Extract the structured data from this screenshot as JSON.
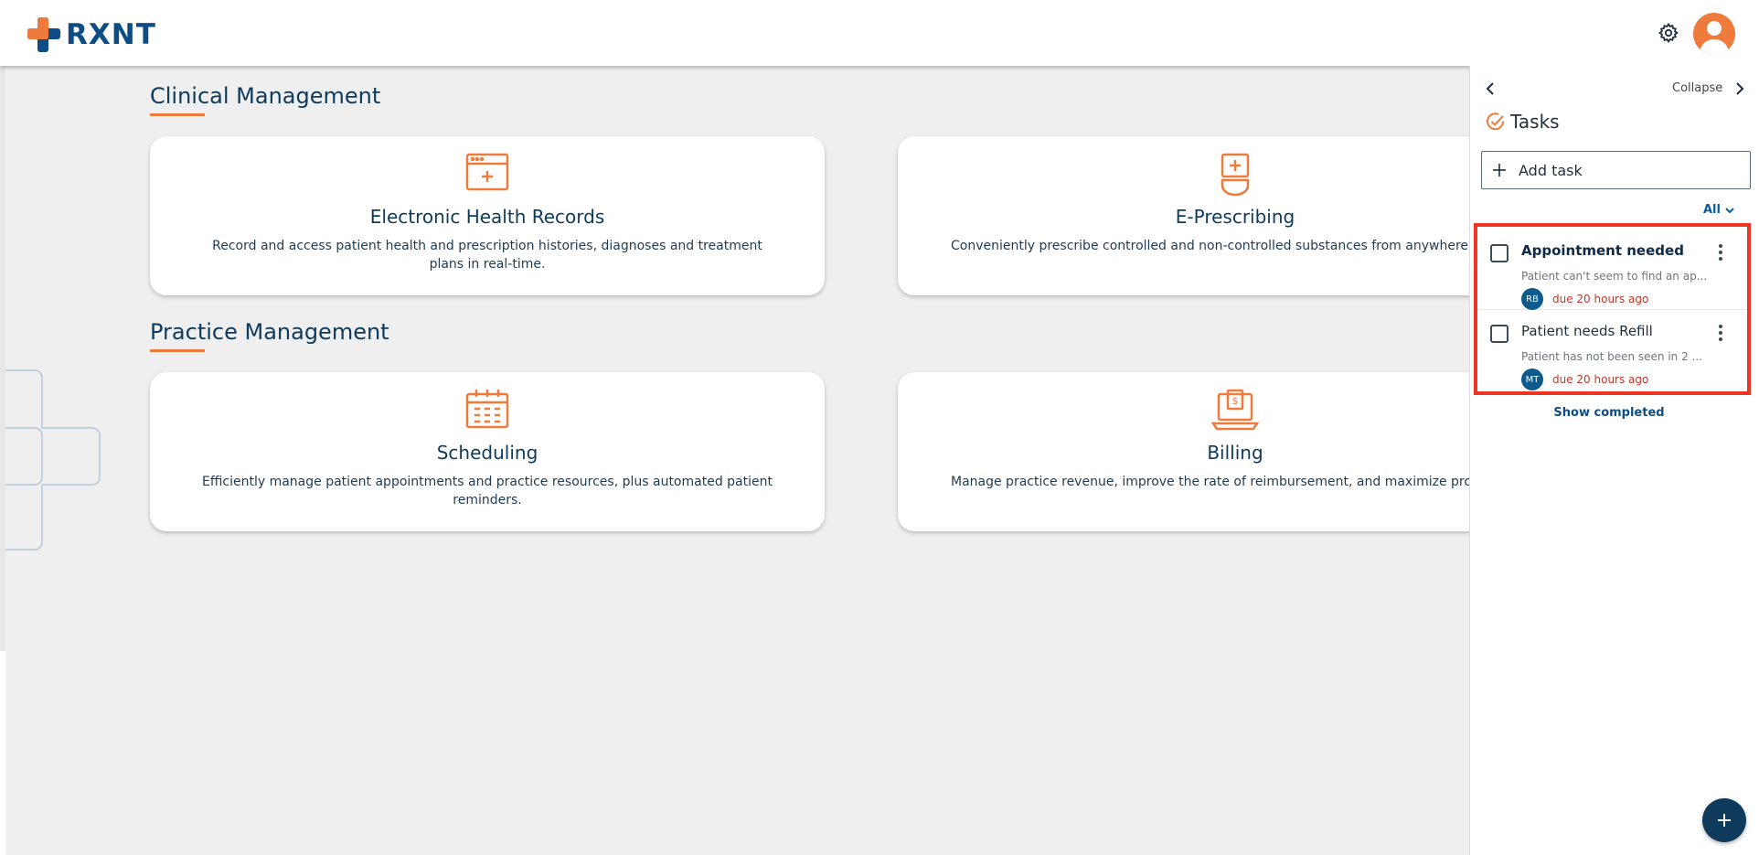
{
  "app": {
    "logo_text": "RXNT",
    "brand_color": "#ee7a3c",
    "primary_color": "#0e4c85"
  },
  "header": {
    "settings_icon": "gear-icon",
    "avatar_icon": "user-avatar-icon"
  },
  "main": {
    "sections": [
      {
        "title": "Clinical Management",
        "cards": [
          {
            "title": "Electronic Health Records",
            "description": "Record and access patient health and prescription histories, diagnoses and treatment plans in real-time.",
            "icon": "ehr-browser-icon"
          },
          {
            "title": "E-Prescribing",
            "description": "Conveniently prescribe controlled and non-controlled substances from anywhere, at a",
            "icon": "pill-bottle-icon"
          }
        ]
      },
      {
        "title": "Practice Management",
        "cards": [
          {
            "title": "Scheduling",
            "description": "Efficiently manage patient appointments and practice resources, plus automated patient reminders.",
            "icon": "calendar-icon"
          },
          {
            "title": "Billing",
            "description": "Manage practice revenue, improve the rate of reimbursement, and maximize profita",
            "icon": "laptop-billing-icon"
          }
        ]
      }
    ]
  },
  "tasks_panel": {
    "collapse_label": "Collapse",
    "title": "Tasks",
    "add_task_label": "Add task",
    "filter_label": "All",
    "tasks": [
      {
        "title": "Appointment needed",
        "subtitle": "Patient can't seem to find an ap...",
        "initials": "RB",
        "due": "due 20 hours ago"
      },
      {
        "title": "Patient needs Refill",
        "subtitle": "Patient has not been seen in 2 ...",
        "initials": "MT",
        "due": "due 20 hours ago"
      }
    ],
    "show_completed_label": "Show completed",
    "highlight_color": "#ee3524"
  }
}
